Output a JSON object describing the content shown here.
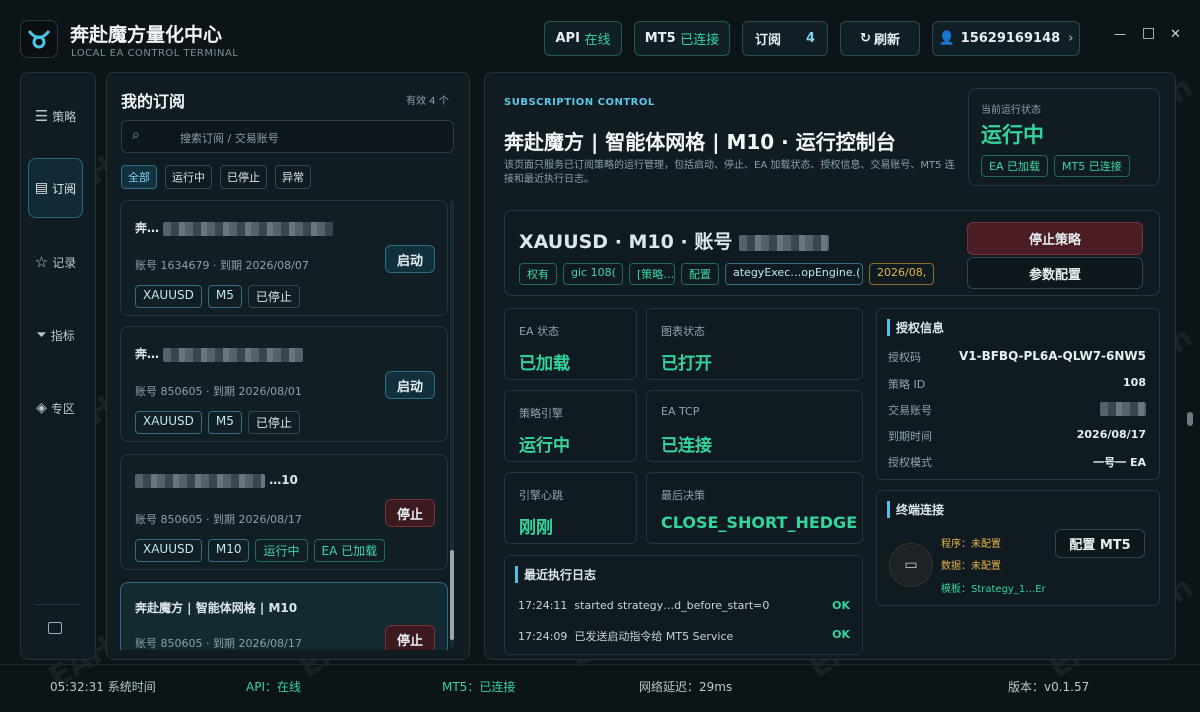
{
  "app": {
    "title": "奔赴魔方量化中心",
    "subtitle": "LOCAL EA CONTROL TERMINAL"
  },
  "topbar": {
    "api_label": "API",
    "api_status": "在线",
    "mt5_label": "MT5",
    "mt5_status": "已连接",
    "sub_label": "订阅",
    "sub_count": "4",
    "refresh_label": "刷新",
    "user_phone": "15629169148",
    "user_chevron": "›"
  },
  "window": {
    "minimize": "—",
    "maximize": "□",
    "close": "✕"
  },
  "nav": {
    "items": [
      {
        "label": "策略"
      },
      {
        "label": "订阅"
      },
      {
        "label": "记录"
      },
      {
        "label": "指标"
      },
      {
        "label": "专区"
      }
    ]
  },
  "subs": {
    "title": "我的订阅",
    "valid_count": "有效 4 个",
    "search_placeholder": "搜索订阅 / 交易账号",
    "filters": [
      "全部",
      "运行中",
      "已停止",
      "异常"
    ],
    "cards": [
      {
        "title": "奔…",
        "account": "账号 1634679 · 到期 2026/08/07",
        "tags": [
          "XAUUSD",
          "M5",
          "已停止"
        ],
        "action": "启动"
      },
      {
        "title": "奔…",
        "account": "账号 850605 · 到期 2026/08/01",
        "tags": [
          "XAUUSD",
          "M5",
          "已停止"
        ],
        "action": "启动"
      },
      {
        "title": "…10",
        "account": "账号 850605 · 到期 2026/08/17",
        "tags": [
          "XAUUSD",
          "M10",
          "运行中",
          "EA 已加载"
        ],
        "action": "停止"
      },
      {
        "title": "奔赴魔方 | 智能体网格 | M10",
        "account": "账号 850605 · 到期 2026/08/17",
        "tags": [],
        "action": "停止"
      }
    ]
  },
  "control": {
    "eyebrow": "SUBSCRIPTION CONTROL",
    "title": "奔赴魔方 | 智能体网格 | M10 · 运行控制台",
    "desc": "该页面只服务已订阅策略的运行管理，包括启动、停止、EA 加载状态、授权信息、交易账号、MT5 连接和最近执行日志。",
    "status_label": "当前运行状态",
    "status_value": "运行中",
    "status_badges": [
      "EA 已加载",
      "MT5 已连接"
    ]
  },
  "strategy": {
    "title": "XAUUSD · M10 · 账号",
    "chips": [
      "权有",
      "gic 108(",
      "[策略…",
      "配置",
      "ategyExec…opEngine.(",
      "2026/08,"
    ],
    "stop_button": "停止策略",
    "config_button": "参数配置"
  },
  "stats": [
    {
      "label": "EA 状态",
      "value": "已加载"
    },
    {
      "label": "图表状态",
      "value": "已打开"
    },
    {
      "label": "策略引擎",
      "value": "运行中"
    },
    {
      "label": "EA TCP",
      "value": "已连接"
    },
    {
      "label": "引擎心跳",
      "value": "刚刚"
    },
    {
      "label": "最后决策",
      "value": "CLOSE_SHORT_HEDGE"
    }
  ],
  "auth": {
    "title": "授权信息",
    "rows": [
      {
        "k": "授权码",
        "v": "V1-BFBQ-PL6A-QLW7-6NW5"
      },
      {
        "k": "策略 ID",
        "v": "108"
      },
      {
        "k": "交易账号",
        "v": ""
      },
      {
        "k": "到期时间",
        "v": "2026/08/17"
      },
      {
        "k": "授权模式",
        "v": "一号一 EA"
      }
    ]
  },
  "terminal": {
    "title": "终端连接",
    "program_label": "程序：",
    "program_value": "未配置",
    "data_label": "数据：",
    "data_value": "未配置",
    "template_label": "模板：",
    "template_value": "Strategy_1…Er",
    "config_button": "配置 MT5"
  },
  "log": {
    "title": "最近执行日志",
    "rows": [
      {
        "time": "17:24:11",
        "msg": "started strategy…d_before_start=0",
        "status": "OK"
      },
      {
        "time": "17:24:09",
        "msg": "已发送启动指令给 MT5 Service",
        "status": "OK"
      }
    ]
  },
  "statusbar": {
    "time": "05:32:31 系统时间",
    "api": "API：在线",
    "mt5": "MT5：已连接",
    "latency": "网络延迟：29ms",
    "version": "版本：v0.1.57"
  },
  "watermark": "EAHub.cn",
  "colors": {
    "accent": "#34d4a0",
    "stop": "#4a1d24",
    "bg": "#0c1418"
  }
}
